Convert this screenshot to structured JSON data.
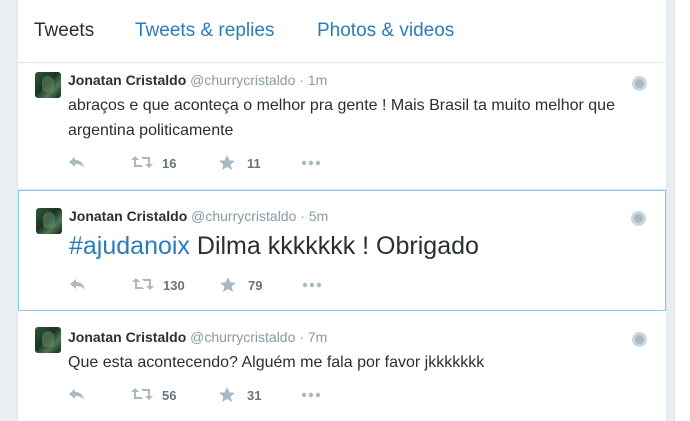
{
  "tabs": [
    {
      "label": "Tweets"
    },
    {
      "label": "Tweets & replies"
    },
    {
      "label": "Photos & videos"
    }
  ],
  "tweets": [
    {
      "name": "Jonatan Cristaldo",
      "handle": "@churrycristaldo",
      "separator": "·",
      "time": "1m",
      "text": "abraços e que aconteça o melhor pra gente ! Mais Brasil ta muito melhor que argentina politicamente",
      "retweets": "16",
      "favorites": "11"
    },
    {
      "name": "Jonatan Cristaldo",
      "handle": "@churrycristaldo",
      "separator": "·",
      "time": "5m",
      "hashtag": "#ajudanoix",
      "text": " Dilma kkkkkkk ! Obrigado",
      "retweets": "130",
      "favorites": "79"
    },
    {
      "name": "Jonatan Cristaldo",
      "handle": "@churrycristaldo",
      "separator": "·",
      "time": "7m",
      "text": "Que esta acontecendo? Alguém me fala por favor jkkkkkkk",
      "retweets": "56",
      "favorites": "31"
    }
  ],
  "icons": {
    "reply": "reply-icon",
    "retweet": "retweet-icon",
    "favorite": "star-icon",
    "more": "more-icon",
    "globe": "globe-icon"
  },
  "colors": {
    "link": "#2b7bb9",
    "text": "#292f33",
    "muted": "#8899a6",
    "focus_border": "#88c9e6"
  }
}
